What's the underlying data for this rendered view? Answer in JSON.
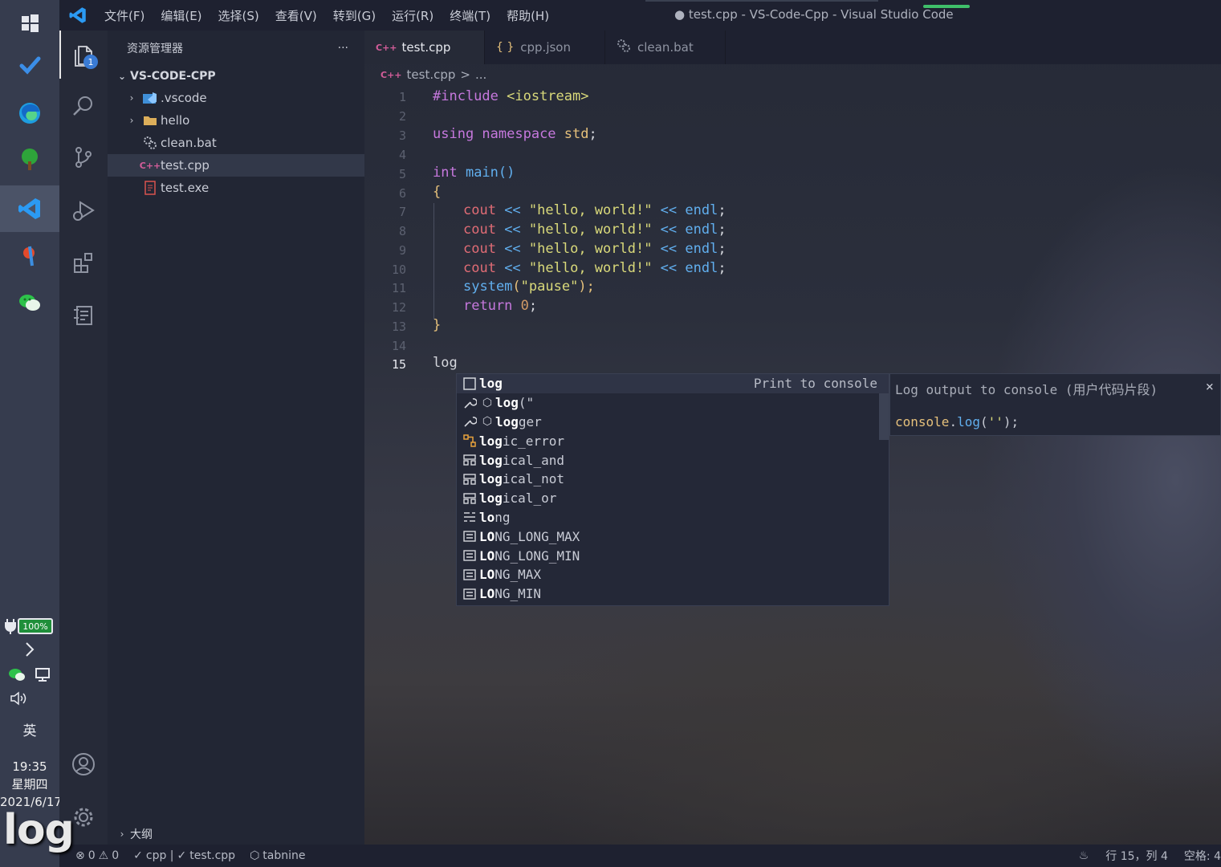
{
  "window": {
    "title": "● test.cpp - VS-Code-Cpp - Visual Studio Code"
  },
  "menu": [
    "文件(F)",
    "编辑(E)",
    "选择(S)",
    "查看(V)",
    "转到(G)",
    "运行(R)",
    "终端(T)",
    "帮助(H)"
  ],
  "taskbar": {
    "battery": "100%",
    "ime": "英",
    "time": "19:35",
    "weekday": "星期四",
    "date": "2021/6/17",
    "overlay_text": "log"
  },
  "activity": {
    "explorer_badge": "1"
  },
  "sidebar": {
    "title": "资源管理器",
    "more": "···",
    "root": "VS-CODE-CPP",
    "items": [
      {
        "label": ".vscode",
        "icon": "vscode-folder-icon"
      },
      {
        "label": "hello",
        "icon": "folder-icon"
      },
      {
        "label": "clean.bat",
        "icon": "gears-icon"
      },
      {
        "label": "test.cpp",
        "icon": "cpp-file-icon"
      },
      {
        "label": "test.exe",
        "icon": "exe-file-icon"
      }
    ],
    "outline": "大纲"
  },
  "tabs": [
    {
      "label": "test.cpp",
      "icon": "C++",
      "modified": true
    },
    {
      "label": "cpp.json",
      "icon": "{ }"
    },
    {
      "label": "clean.bat",
      "icon": "gears-icon"
    }
  ],
  "breadcrumb": {
    "file": "test.cpp",
    "icon": "C++",
    "sep": ">",
    "more": "..."
  },
  "editor": {
    "line_numbers": [
      "1",
      "2",
      "3",
      "4",
      "5",
      "6",
      "7",
      "8",
      "9",
      "10",
      "11",
      "12",
      "13",
      "14",
      "15"
    ],
    "code": {
      "l1_a": "#include",
      "l1_b": " <iostream>",
      "l3_a": "using",
      "l3_b": " namespace",
      "l3_c": " std",
      "l3_d": ";",
      "l5_a": "int",
      "l5_b": " main",
      "l5_c": "()",
      "l6": "{",
      "cout": "cout",
      "op": " << ",
      "hello": "\"hello, world!\"",
      "endl": "endl",
      "semi": ";",
      "l11_a": "system",
      "l11_b": "(",
      "l11_c": "\"pause\"",
      "l11_d": ");",
      "l12_a": "return",
      "l12_b": " 0",
      "l12_c": ";",
      "l13": "}",
      "l15": "log"
    }
  },
  "suggestions": [
    {
      "bold": "log",
      "rest": "",
      "icon": "snippet-icon",
      "detail": "Print to console"
    },
    {
      "bold": "log",
      "rest": "(\"",
      "icon": "tabnine-tool-icon"
    },
    {
      "bold": "log",
      "rest": "ger",
      "icon": "tabnine-tool-icon"
    },
    {
      "bold": "log",
      "rest": "ic_error",
      "icon": "class-icon"
    },
    {
      "bold": "log",
      "rest": "ical_and",
      "icon": "struct-icon"
    },
    {
      "bold": "log",
      "rest": "ical_not",
      "icon": "struct-icon"
    },
    {
      "bold": "log",
      "rest": "ical_or",
      "icon": "struct-icon"
    },
    {
      "bold": "lo",
      "rest": "ng",
      "icon": "keyword-icon"
    },
    {
      "bold": "LO",
      "rest": "NG_LONG_MAX",
      "icon": "constant-icon"
    },
    {
      "bold": "LO",
      "rest": "NG_LONG_MIN",
      "icon": "constant-icon"
    },
    {
      "bold": "LO",
      "rest": "NG_MAX",
      "icon": "constant-icon"
    },
    {
      "bold": "LO",
      "rest": "NG_MIN",
      "icon": "constant-icon"
    }
  ],
  "details": {
    "title": "Log output to console (用户代码片段)",
    "code_a": "console",
    "code_b": ".",
    "code_c": "log",
    "code_d": "(",
    "code_e": "''",
    "code_f": ");",
    "close": "×"
  },
  "status": {
    "errors": "0",
    "warnings": "0",
    "lang": "cpp |",
    "file": "test.cpp",
    "tabnine": "tabnine",
    "position": "行 15，列 4",
    "spaces": "空格: 4"
  }
}
